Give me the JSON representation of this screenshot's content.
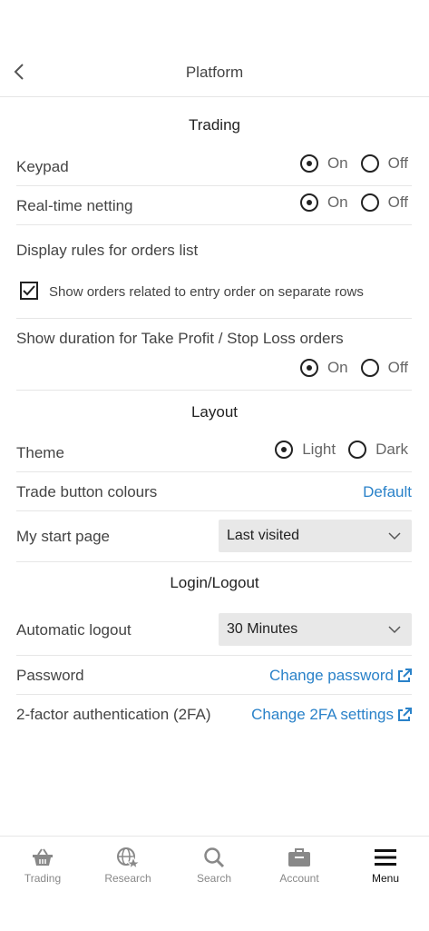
{
  "header": {
    "title": "Platform"
  },
  "sections": {
    "trading": "Trading",
    "layout": "Layout",
    "login": "Login/Logout"
  },
  "trading": {
    "keypad": {
      "label": "Keypad",
      "on": "On",
      "off": "Off",
      "selected": "On"
    },
    "netting": {
      "label": "Real-time netting",
      "on": "On",
      "off": "Off",
      "selected": "On"
    },
    "display_rules_label": "Display rules for orders list",
    "show_orders_checkbox": {
      "label": "Show orders related to entry order on separate rows",
      "checked": true
    },
    "duration": {
      "label": "Show duration for Take Profit / Stop Loss orders",
      "on": "On",
      "off": "Off",
      "selected": "On"
    }
  },
  "layout": {
    "theme": {
      "label": "Theme",
      "light": "Light",
      "dark": "Dark",
      "selected": "Light"
    },
    "trade_colours": {
      "label": "Trade button colours",
      "value": "Default"
    },
    "start_page": {
      "label": "My start page",
      "value": "Last visited"
    }
  },
  "login": {
    "auto_logout": {
      "label": "Automatic logout",
      "value": "30 Minutes"
    },
    "password": {
      "label": "Password",
      "link": "Change password"
    },
    "twofa": {
      "label": "2-factor authentication (2FA)",
      "link": "Change 2FA settings"
    }
  },
  "tabs": [
    {
      "label": "Trading",
      "icon": "basket-icon"
    },
    {
      "label": "Research",
      "icon": "globe-star-icon"
    },
    {
      "label": "Search",
      "icon": "search-icon"
    },
    {
      "label": "Account",
      "icon": "briefcase-icon"
    },
    {
      "label": "Menu",
      "icon": "hamburger-icon",
      "active": true
    }
  ],
  "colors": {
    "accent": "#2a82c9",
    "text": "#444444",
    "divider": "#e6e6e6"
  }
}
